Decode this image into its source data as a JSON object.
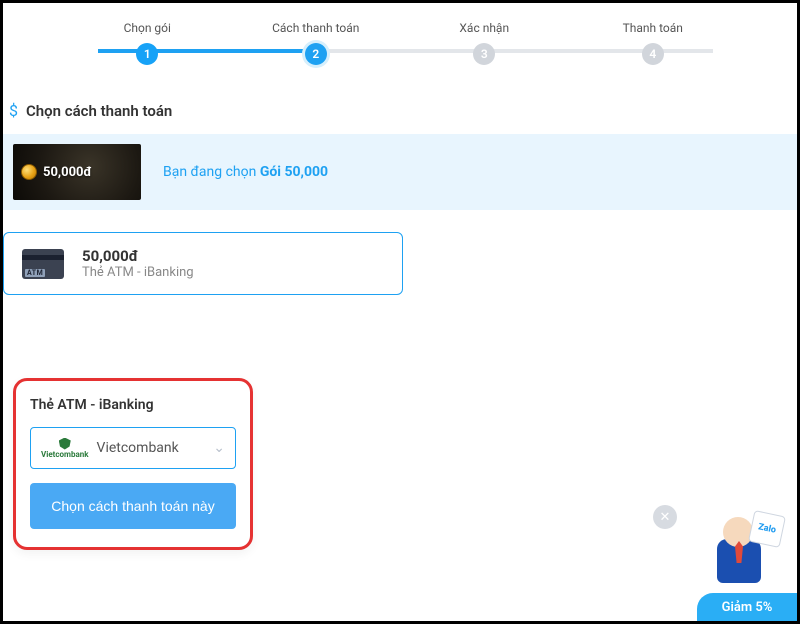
{
  "steps": [
    {
      "label": "Chọn gói",
      "num": "1",
      "state": "done"
    },
    {
      "label": "Cách thanh toán",
      "num": "2",
      "state": "active"
    },
    {
      "label": "Xác nhận",
      "num": "3",
      "state": "inactive"
    },
    {
      "label": "Thanh toán",
      "num": "4",
      "state": "inactive"
    }
  ],
  "section_title": "Chọn cách thanh toán",
  "package": {
    "price": "50,000đ",
    "desc_prefix": "Bạn đang chọn ",
    "desc_bold": "Gói 50,000"
  },
  "option": {
    "amount": "50,000đ",
    "method": "Thẻ ATM - iBanking"
  },
  "bank_panel": {
    "title": "Thẻ ATM - iBanking",
    "logo_text": "Vietcombank",
    "selected_bank": "Vietcombank",
    "confirm": "Chọn cách thanh toán này"
  },
  "widget": {
    "card": "Zalo",
    "discount": "Giảm 5%"
  },
  "colors": {
    "primary": "#1ea1f2",
    "highlight_border": "#e53232"
  }
}
